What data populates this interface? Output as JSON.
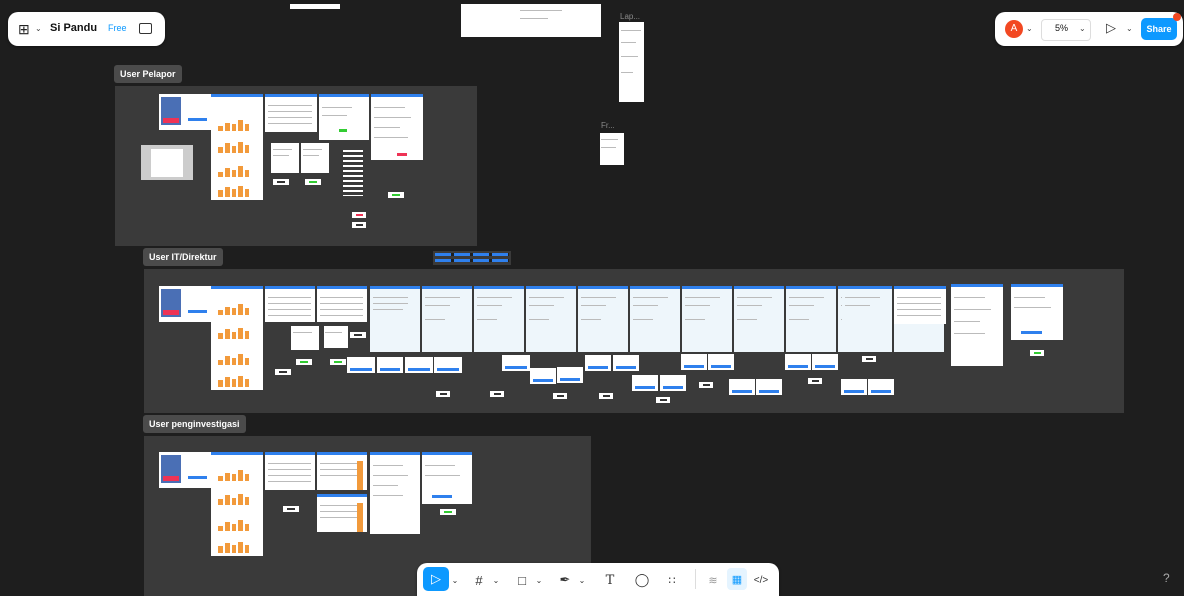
{
  "top_left": {
    "file_name": "Si Pandu",
    "plan_badge": "Free"
  },
  "top_right": {
    "avatar_initial": "A",
    "zoom": "5%",
    "share_label": "Share"
  },
  "canvas": {
    "ghost_labels": {
      "lap": "Lap...",
      "fr": "Fr..."
    },
    "sections": {
      "pelapor": "User Pelapor",
      "it_direktur": "User IT/Direktur",
      "penginvestigasi": "User penginvestigasi"
    }
  },
  "help_label": "?",
  "colors": {
    "canvas": "#1e1e1e",
    "section": "#3a3a3a",
    "accent": "#2f80ed",
    "chart_bar": "#f29a3b",
    "share_button": "#0d99ff",
    "avatar": "#f24822"
  },
  "icons": {
    "toolbar": [
      "move-tool-icon",
      "frame-tool-icon",
      "shape-tool-icon",
      "pen-tool-icon",
      "text-tool-icon",
      "comment-tool-icon",
      "actions-icon",
      "draw-mode-icon",
      "design-mode-icon",
      "dev-mode-icon"
    ]
  }
}
